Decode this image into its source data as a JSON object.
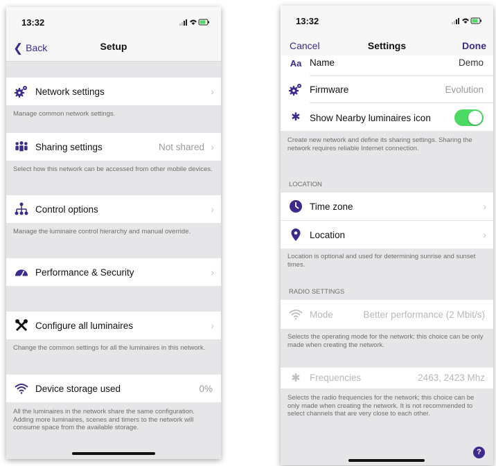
{
  "left": {
    "status_time": "13:32",
    "back_label": "Back",
    "title": "Setup",
    "rows": {
      "network": {
        "label": "Network settings",
        "note": "Manage common network settings."
      },
      "sharing": {
        "label": "Sharing settings",
        "value": "Not shared",
        "note": "Select how this network can be accessed from other mobile devices."
      },
      "control": {
        "label": "Control options",
        "note": "Manage the luminaire control hierarchy and manual override."
      },
      "performance": {
        "label": "Performance & Security"
      },
      "configure": {
        "label": "Configure all luminaires",
        "note": "Change the common settings for all the luminaires in this network."
      },
      "storage": {
        "label": "Device storage used",
        "value": "0%",
        "note": "All the luminaires in the network share the same configuration. Adding more luminaires, scenes and timers to the network will consume space from the available storage."
      }
    }
  },
  "right": {
    "status_time": "13:32",
    "cancel_label": "Cancel",
    "title": "Settings",
    "done_label": "Done",
    "name_icon": "Aa",
    "name": {
      "label": "Name",
      "value": "Demo"
    },
    "firmware": {
      "label": "Firmware",
      "value": "Evolution"
    },
    "nearby": {
      "label": "Show Nearby luminaires icon",
      "enabled": true
    },
    "network_note": "Create new network and define its sharing settings. Sharing the network requires reliable Internet connection.",
    "location_header": "LOCATION",
    "timezone": {
      "label": "Time zone"
    },
    "location": {
      "label": "Location"
    },
    "location_note": "Location is optional and used for determining sunrise and sunset times.",
    "radio_header": "RADIO SETTINGS",
    "mode": {
      "label": "Mode",
      "value": "Better performance (2 Mbit/s)"
    },
    "mode_note": "Selects the operating mode for the network; this choice can be only made when creating the network.",
    "frequencies": {
      "label": "Frequencies",
      "value": "2463, 2423 Mhz"
    },
    "frequencies_note": "Selects the radio frequencies for the network; this choice can be only made when creating the network. It is not recommended to select channels that are very close to each other.",
    "help_label": "?"
  },
  "colors": {
    "accent": "#3d2a8c",
    "toggle_on": "#4cd964",
    "group_bg": "#e6e6e8"
  },
  "icons": [
    "gears-icon",
    "people-icon",
    "hierarchy-icon",
    "speedometer-icon",
    "tools-icon",
    "wifi-icon",
    "bluetooth-icon",
    "clock-icon",
    "location-pin-icon",
    "chevron-right-icon",
    "back-chevron-icon",
    "help-icon",
    "signal-icon",
    "battery-icon"
  ]
}
